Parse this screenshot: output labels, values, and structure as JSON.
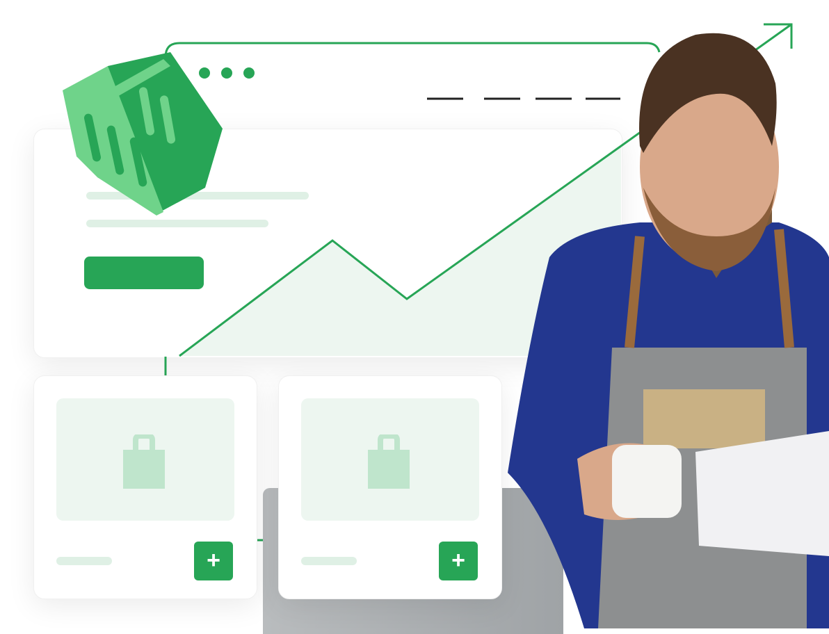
{
  "colors": {
    "accent": "#27a556",
    "accent_light": "#6fd38a",
    "placeholder": "#edf6f0",
    "bag_icon": "#bfe5cc",
    "pill": "#dff0e5",
    "shirt": "#23378f",
    "apron": "#8d8f90"
  },
  "products": [
    {
      "add_label": "+"
    },
    {
      "add_label": "+"
    }
  ],
  "icons": [
    "shopping-basket-icon",
    "shopping-bag-icon",
    "trend-arrow-icon",
    "plus-icon"
  ]
}
